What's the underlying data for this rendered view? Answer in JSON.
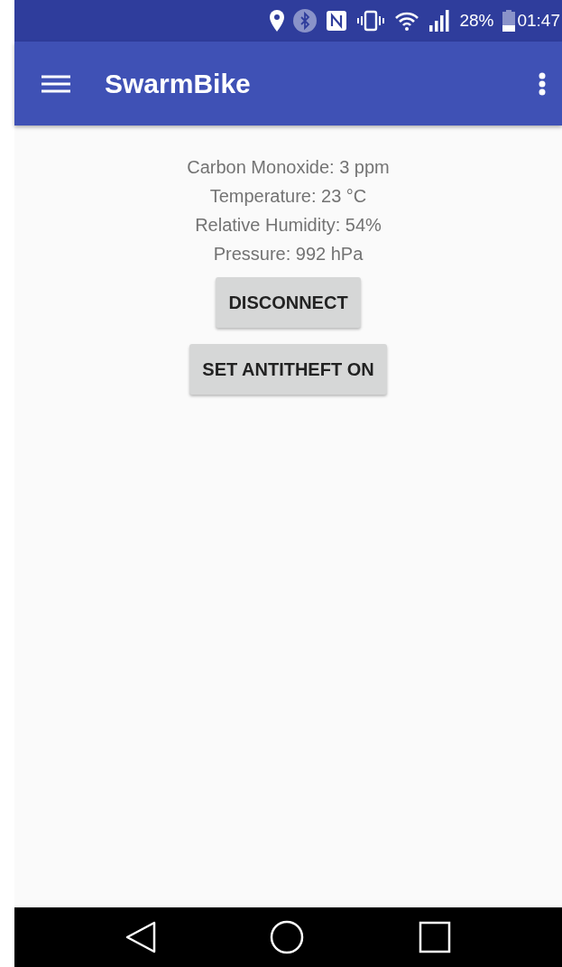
{
  "status_bar": {
    "battery_text": "28%",
    "time": "01:47"
  },
  "app_bar": {
    "title": "SwarmBike"
  },
  "readings": [
    "Carbon Monoxide: 3 ppm",
    "Temperature: 23 °C",
    "Relative Humidity: 54%",
    "Pressure: 992 hPa"
  ],
  "buttons": [
    "DISCONNECT",
    "SET ANTITHEFT ON"
  ]
}
